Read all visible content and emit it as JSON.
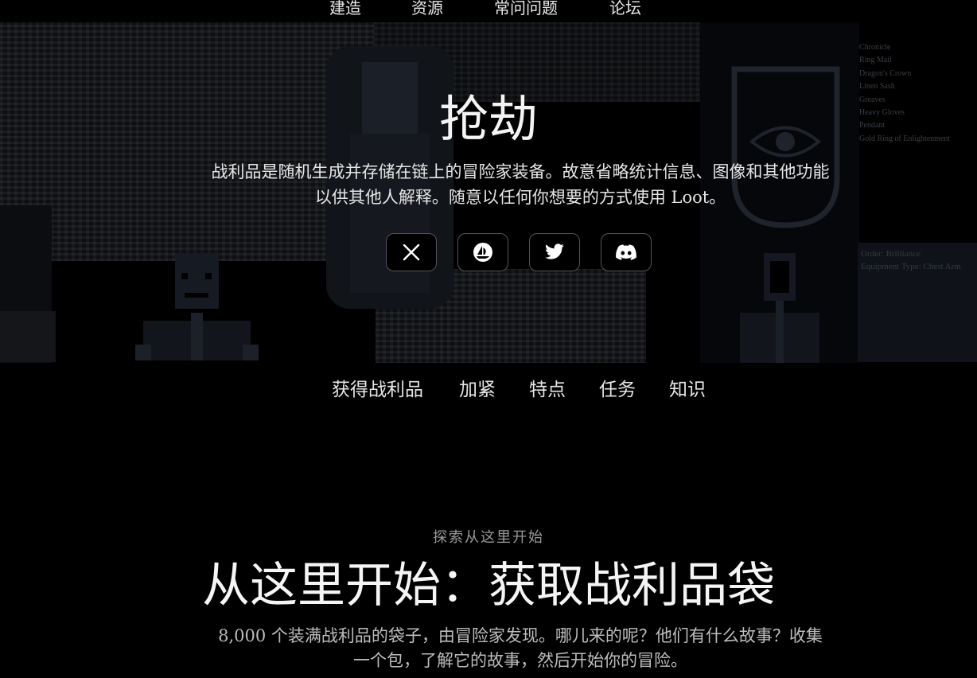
{
  "top_nav": [
    "建造",
    "资源",
    "常问问题",
    "论坛"
  ],
  "hero": {
    "title": "抢劫",
    "description_line1": "战利品是随机生成并存储在链上的冒险家装备。故意省略统计信息、图像和其他功能",
    "description_line2": "以供其他人解释。随意以任何你想要的方式使用 Loot。",
    "socials": [
      {
        "name": "x-link",
        "icon": "x-icon"
      },
      {
        "name": "opensea-link",
        "icon": "opensea-icon"
      },
      {
        "name": "twitter-link",
        "icon": "twitter-bird-icon"
      },
      {
        "name": "discord-link",
        "icon": "discord-icon"
      }
    ],
    "background_loot_list": [
      "Chronicle",
      "Ring Mail",
      "Dragon's Crown",
      "Linen Sash",
      "Greaves",
      "Heavy Gloves",
      "Pendant",
      "Gold Ring of Enlightenment"
    ],
    "background_card": {
      "line1": "Order: Brilliance",
      "line2": "Equipment Type: Chest Arm"
    }
  },
  "sub_nav": [
    "获得战利品",
    "加紧",
    "特点",
    "任务",
    "知识"
  ],
  "section": {
    "eyebrow": "探索从这里开始",
    "title": "从这里开始：获取战利品袋",
    "description_line1": "8,000 个装满战利品的袋子，由冒险家发现。哪儿来的呢？他们有什么故事？收集",
    "description_line2": "一个包，了解它的故事，然后开始你的冒险。"
  },
  "colors": {
    "background": "#000000",
    "text": "#ffffff",
    "muted": "#bdbdbd",
    "button_border": "#555555"
  }
}
